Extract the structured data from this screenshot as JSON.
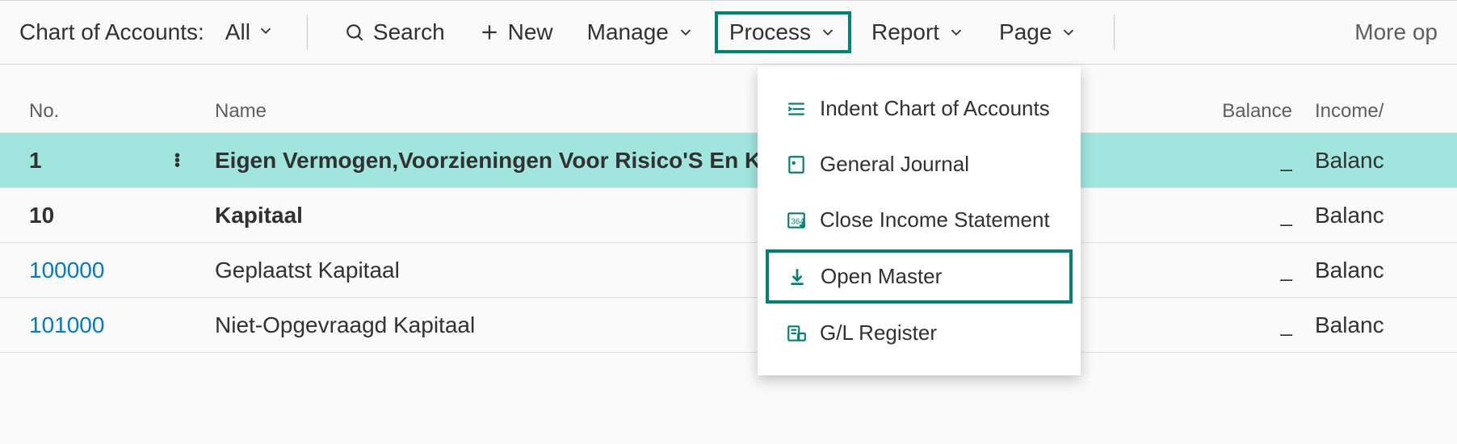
{
  "toolbar": {
    "title_label": "Chart of Accounts:",
    "filter_label": "All",
    "search_label": "Search",
    "new_label": "New",
    "manage_label": "Manage",
    "process_label": "Process",
    "report_label": "Report",
    "page_label": "Page",
    "more_options_label": "More op"
  },
  "columns": {
    "no": "No.",
    "name": "Name",
    "balance": "Balance",
    "income": "Income/"
  },
  "rows": [
    {
      "no": "1",
      "name": "Eigen Vermogen,Voorzieningen Voor Risico'S En Kost",
      "balance": "_",
      "income": "Balanc",
      "bold": true,
      "selected": true,
      "link": false
    },
    {
      "no": "10",
      "name": "Kapitaal",
      "balance": "_",
      "income": "Balanc",
      "bold": true,
      "selected": false,
      "link": false
    },
    {
      "no": "100000",
      "name": "Geplaatst Kapitaal",
      "balance": "_",
      "income": "Balanc",
      "bold": false,
      "selected": false,
      "link": true
    },
    {
      "no": "101000",
      "name": "Niet-Opgevraagd Kapitaal",
      "balance": "_",
      "income": "Balanc",
      "bold": false,
      "selected": false,
      "link": true
    }
  ],
  "process_menu": {
    "items": [
      {
        "icon": "indent-icon",
        "label": "Indent Chart of Accounts",
        "highlighted": false
      },
      {
        "icon": "journal-icon",
        "label": "General Journal",
        "highlighted": false
      },
      {
        "icon": "close-statement-icon",
        "label": "Close Income Statement",
        "highlighted": false
      },
      {
        "icon": "download-icon",
        "label": "Open Master",
        "highlighted": true
      },
      {
        "icon": "register-icon",
        "label": "G/L Register",
        "highlighted": false
      }
    ]
  },
  "colors": {
    "accent": "#008272",
    "selection": "#a0e6de",
    "link": "#0078d4"
  }
}
